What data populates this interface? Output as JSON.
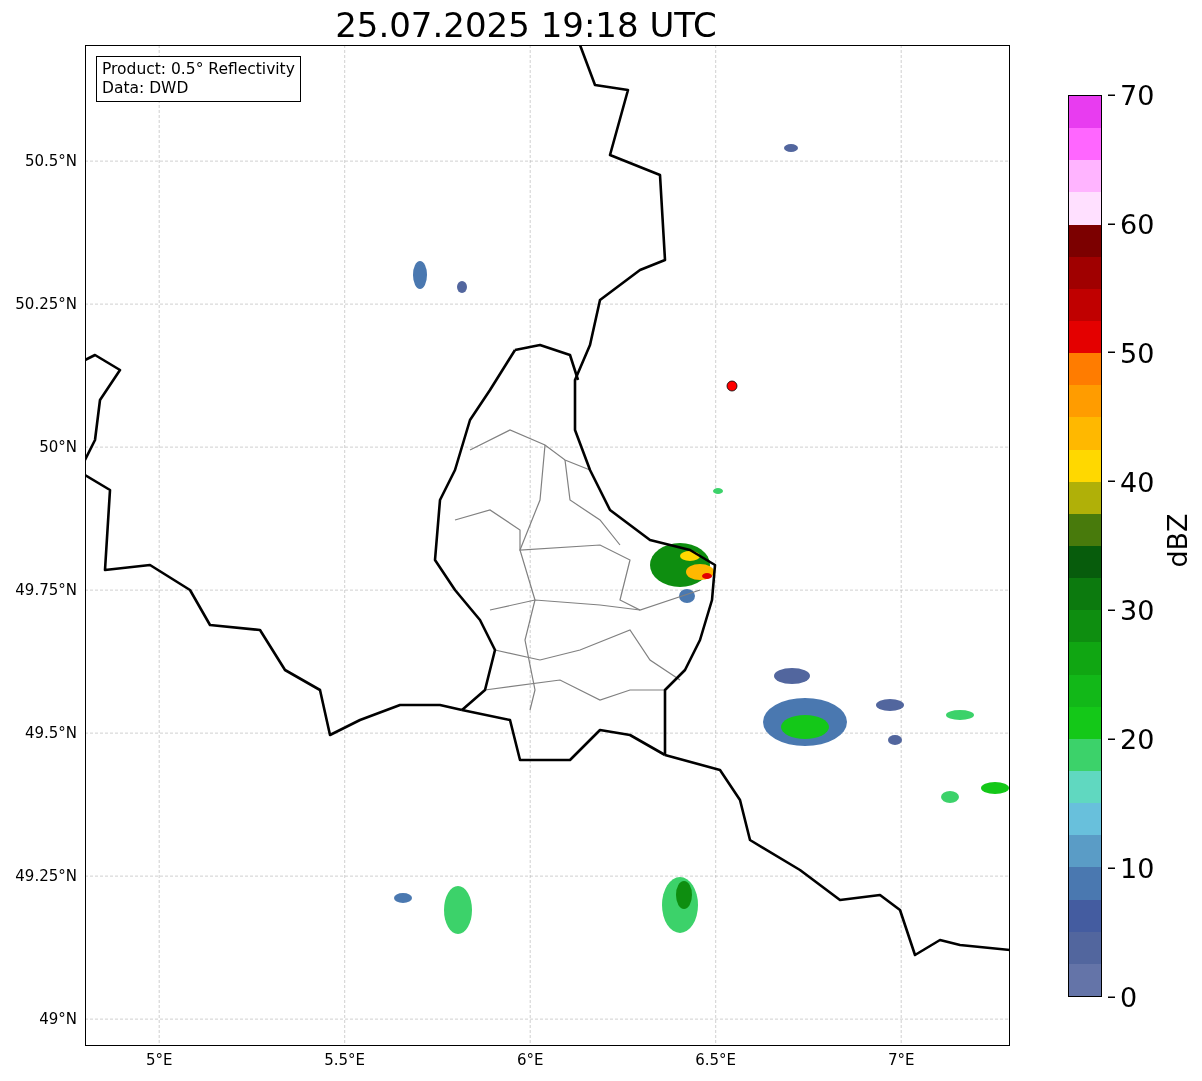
{
  "title": "25.07.2025 19:18 UTC",
  "info_box": [
    "Product: 0.5° Reflectivity",
    "Data: DWD"
  ],
  "y_ticks": [
    "50.5°N",
    "50.25°N",
    "50°N",
    "49.75°N",
    "49.5°N",
    "49.25°N",
    "49°N"
  ],
  "x_ticks": [
    "5°E",
    "5.5°E",
    "6°E",
    "6.5°E",
    "7°E"
  ],
  "colorbar": {
    "label": "dBZ",
    "ticks": [
      "70",
      "60",
      "50",
      "40",
      "30",
      "20",
      "10",
      "0"
    ],
    "bins": [
      {
        "color": "#6474a8"
      },
      {
        "color": "#52669e"
      },
      {
        "color": "#445ca0"
      },
      {
        "color": "#4a78b0"
      },
      {
        "color": "#5a9cc6"
      },
      {
        "color": "#68c0dc"
      },
      {
        "color": "#60d8c0"
      },
      {
        "color": "#3cd26a"
      },
      {
        "color": "#14c818"
      },
      {
        "color": "#12b818"
      },
      {
        "color": "#10a612"
      },
      {
        "color": "#0e8e10"
      },
      {
        "color": "#0c7a0e"
      },
      {
        "color": "#075c0c"
      },
      {
        "color": "#487a0c"
      },
      {
        "color": "#b0b008"
      },
      {
        "color": "#ffd800"
      },
      {
        "color": "#ffb800"
      },
      {
        "color": "#ff9c00"
      },
      {
        "color": "#ff7c00"
      },
      {
        "color": "#e40000"
      },
      {
        "color": "#c00000"
      },
      {
        "color": "#a00000"
      },
      {
        "color": "#7c0000"
      },
      {
        "color": "#ffe0ff"
      },
      {
        "color": "#ffb4ff"
      },
      {
        "color": "#ff66ff"
      },
      {
        "color": "#e83cf0"
      }
    ]
  }
}
